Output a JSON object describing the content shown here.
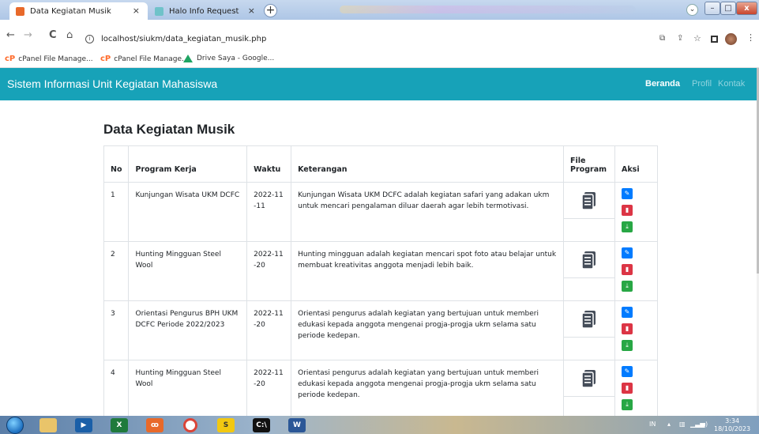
{
  "browser": {
    "tabs": [
      {
        "title": "Data Kegiatan Musik",
        "close": "×"
      },
      {
        "title": "Halo Info Request",
        "close": "×"
      }
    ],
    "new_tab": "+",
    "address": "localhost/siukm/data_kegiatan_musik.php",
    "info_glyph": "i",
    "nav": {
      "back": "←",
      "forward": "→",
      "reload": "C",
      "home": "⌂"
    },
    "bookmarks": [
      {
        "label": "cPanel File Manage...",
        "icon": "cpanel-icon"
      },
      {
        "label": "cPanel File Manage...",
        "icon": "cpanel-icon"
      },
      {
        "label": "Drive Saya - Google...",
        "icon": "google-drive-icon"
      }
    ],
    "window_controls": {
      "minimize": "–",
      "maximize": "□",
      "close": "x"
    },
    "tab_search": "⌄"
  },
  "navbar": {
    "brand": "Sistem Informasi Unit Kegiatan Mahasiswa",
    "links": [
      "Beranda",
      "Profil",
      "Kontak"
    ],
    "colors": {
      "bg": "#17a2b8",
      "active": "#ffffff",
      "inactive": "#8fd3de"
    }
  },
  "main": {
    "title": "Data Kegiatan Musik",
    "headers": {
      "no": "No",
      "program": "Program Kerja",
      "waktu": "Waktu",
      "ket": "Keterangan",
      "file": "File Program",
      "aksi": "Aksi"
    },
    "rows": [
      {
        "no": "1",
        "program": "Kunjungan Wisata UKM DCFC",
        "waktu": "2022-11-11",
        "ket": "Kunjungan Wisata UKM DCFC adalah kegiatan safari yang adakan ukm untuk mencari pengalaman diluar daerah agar lebih termotivasi."
      },
      {
        "no": "2",
        "program": "Hunting Mingguan Steel Wool",
        "waktu": "2022-11-20",
        "ket": "Hunting mingguan adalah kegiatan mencari spot foto atau belajar untuk membuat kreativitas anggota menjadi lebih baik."
      },
      {
        "no": "3",
        "program": "Orientasi Pengurus BPH UKM DCFC Periode 2022/2023",
        "waktu": "2022-11-20",
        "ket": "Orientasi pengurus adalah kegiatan yang bertujuan untuk memberi edukasi kepada anggota mengenai progja-progja ukm selama satu periode kedepan."
      },
      {
        "no": "4",
        "program": "Hunting Mingguan Steel Wool",
        "waktu": "2022-11-20",
        "ket": "Orientasi pengurus adalah kegiatan yang bertujuan untuk memberi edukasi kepada anggota mengenai progja-progja ukm selama satu periode kedepan."
      }
    ],
    "action_colors": {
      "edit": "#007bff",
      "delete": "#dc3545",
      "download": "#28a745"
    }
  },
  "taskbar": {
    "lang": "IN",
    "time": "3:34",
    "date": "18/10/2023"
  }
}
